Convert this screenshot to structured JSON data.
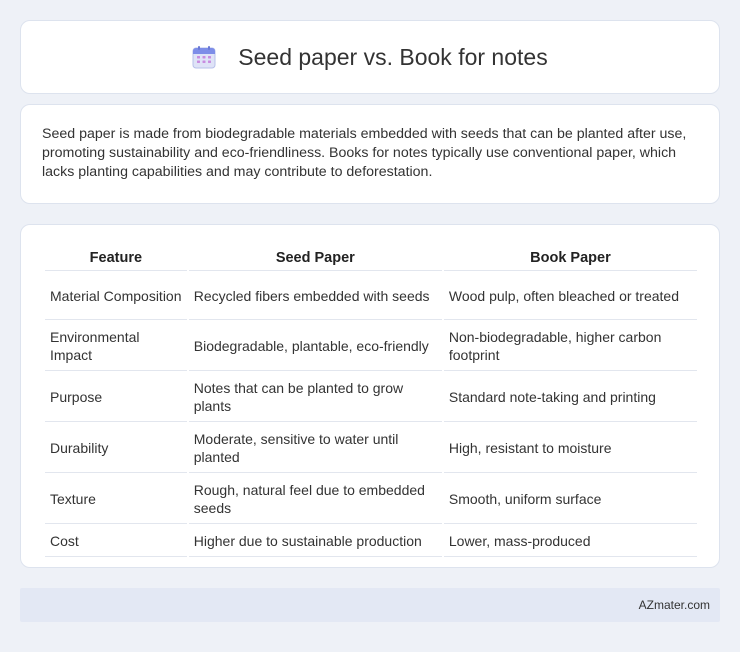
{
  "header": {
    "title": "Seed paper vs. Book for notes",
    "icon": "calendar-icon"
  },
  "description": "Seed paper is made from biodegradable materials embedded with seeds that can be planted after use, promoting sustainability and eco-friendliness. Books for notes typically use conventional paper, which lacks planting capabilities and may contribute to deforestation.",
  "table": {
    "headers": [
      "Feature",
      "Seed Paper",
      "Book Paper"
    ],
    "rows": [
      [
        "Material Composition",
        "Recycled fibers embedded with seeds",
        "Wood pulp, often bleached or treated"
      ],
      [
        "Environmental Impact",
        "Biodegradable, plantable, eco-friendly",
        "Non-biodegradable, higher carbon footprint"
      ],
      [
        "Purpose",
        "Notes that can be planted to grow plants",
        "Standard note-taking and printing"
      ],
      [
        "Durability",
        "Moderate, sensitive to water until planted",
        "High, resistant to moisture"
      ],
      [
        "Texture",
        "Rough, natural feel due to embedded seeds",
        "Smooth, uniform surface"
      ],
      [
        "Cost",
        "Higher due to sustainable production",
        "Lower, mass-produced"
      ]
    ]
  },
  "footer": {
    "brand": "AZmater.com"
  }
}
